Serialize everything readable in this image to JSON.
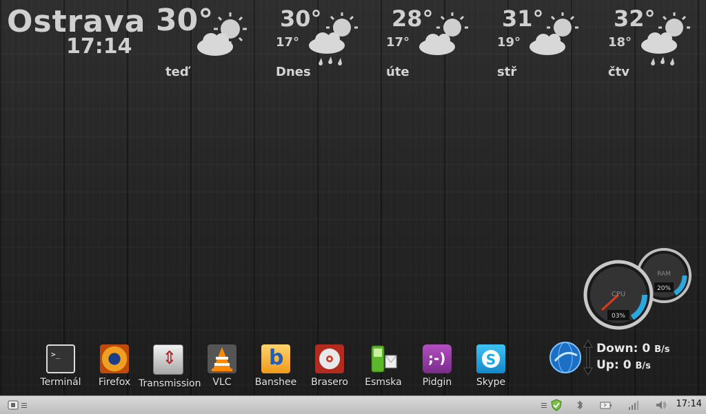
{
  "weather": {
    "city": "Ostrava",
    "time": "17:14",
    "current": {
      "temp": "30°",
      "label": "teď",
      "icon": "partly-cloudy-icon"
    },
    "forecast": [
      {
        "temp": "30°",
        "low": "17°",
        "label": "Dnes",
        "icon": "partly-cloudy-rain-icon"
      },
      {
        "temp": "28°",
        "low": "17°",
        "label": "úte",
        "icon": "partly-cloudy-icon"
      },
      {
        "temp": "31°",
        "low": "19°",
        "label": "stř",
        "icon": "partly-cloudy-icon"
      },
      {
        "temp": "32°",
        "low": "18°",
        "label": "čtv",
        "icon": "partly-cloudy-rain-icon"
      }
    ]
  },
  "dock": {
    "apps": [
      {
        "label": "Terminál",
        "icon": "terminal-icon",
        "color": "#222222"
      },
      {
        "label": "Firefox",
        "icon": "firefox-icon",
        "color": "#e07a10"
      },
      {
        "label": "Transmission",
        "icon": "transmission-icon",
        "color": "#d8d8d8"
      },
      {
        "label": "VLC",
        "icon": "vlc-icon",
        "color": "#ff8800"
      },
      {
        "label": "Banshee",
        "icon": "banshee-icon",
        "color": "#f5a623"
      },
      {
        "label": "Brasero",
        "icon": "brasero-icon",
        "color": "#c0392b"
      },
      {
        "label": "Esmska",
        "icon": "esmska-icon",
        "color": "#6abf2a"
      },
      {
        "label": "Pidgin",
        "icon": "pidgin-icon",
        "color": "#9b3fa4"
      },
      {
        "label": "Skype",
        "icon": "skype-icon",
        "color": "#1aa9e6"
      }
    ]
  },
  "network": {
    "down_label": "Down: 0",
    "down_unit": "B/s",
    "up_label": "Up: 0",
    "up_unit": "B/s"
  },
  "gauges": {
    "cpu_label": "CPU",
    "cpu_value": "03%",
    "ram_label": "RAM",
    "ram_value": "20%"
  },
  "panel": {
    "clock": "17:14"
  }
}
